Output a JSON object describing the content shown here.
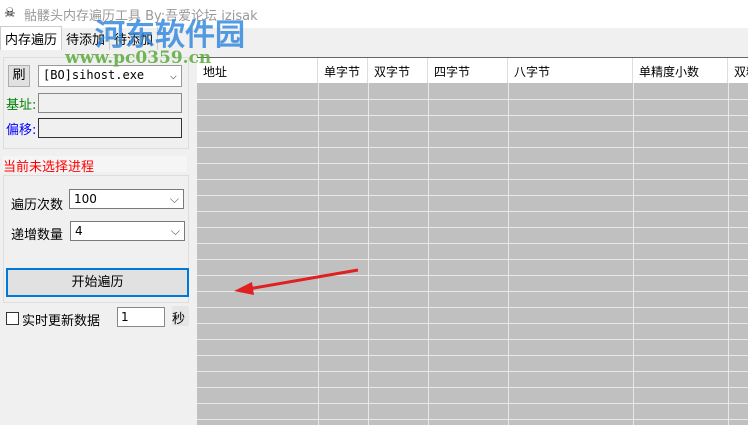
{
  "window": {
    "title": "骷髅头内存遍历工具 By:吾爱论坛 izisak"
  },
  "tabs": [
    {
      "label": "内存遍历"
    },
    {
      "label": "待添加"
    },
    {
      "label": "待添加"
    }
  ],
  "process": {
    "refresh_label": "刷",
    "selected": "[BO]sihost.exe"
  },
  "base_label": "基址:",
  "offset_label": "偏移:",
  "base_value": "",
  "offset_value": "",
  "status": "当前未选择进程",
  "iterations": {
    "label": "遍历次数",
    "value": "100"
  },
  "increment": {
    "label": "递增数量",
    "value": "4"
  },
  "start_label": "开始遍历",
  "realtime": {
    "label": "实时更新数据",
    "checked": false,
    "value": "1",
    "unit": "秒"
  },
  "table": {
    "columns": [
      "地址",
      "单字节",
      "双字节",
      "四字节",
      "八字节",
      "单精度小数",
      "双精度小数"
    ]
  },
  "watermark": {
    "name": "河东软件园",
    "url": "www.pc0359.cn"
  },
  "colors": {
    "base": "#008000",
    "offset": "#0000ff",
    "status": "#ff0000",
    "accent": "#0078d7",
    "arrow": "#e02020"
  }
}
